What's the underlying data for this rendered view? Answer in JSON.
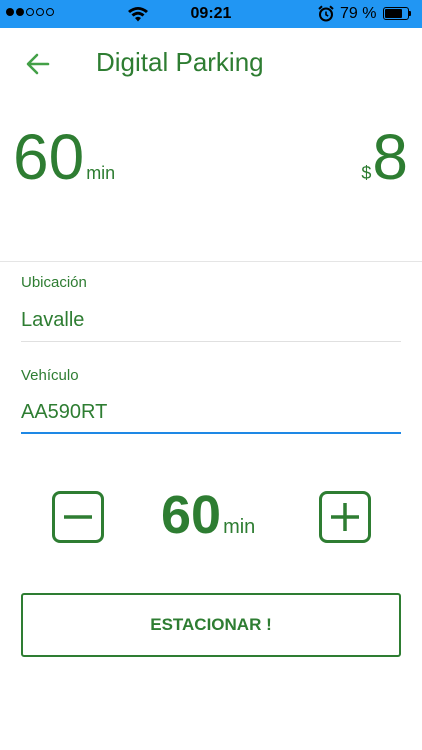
{
  "status_bar": {
    "time": "09:21",
    "battery_percent": "79 %",
    "battery_level": 0.79,
    "signal_bars_filled": 2,
    "signal_bars_total": 5,
    "icons": [
      "signal-dots-icon",
      "wifi-icon",
      "alarm-icon",
      "battery-icon"
    ],
    "background_color": "#2196f3"
  },
  "header": {
    "title": "Digital Parking",
    "back_icon": "arrow-left-icon"
  },
  "summary": {
    "duration_value": "60",
    "duration_unit": "min",
    "price_currency": "$",
    "price_value": "8"
  },
  "form": {
    "location": {
      "label": "Ubicación",
      "value": "Lavalle"
    },
    "vehicle": {
      "label": "Vehículo",
      "value": "AA590RT"
    }
  },
  "stepper": {
    "value": "60",
    "unit": "min",
    "decrement_icon": "minus-square-icon",
    "increment_icon": "plus-square-icon"
  },
  "actions": {
    "park_label": "ESTACIONAR !"
  },
  "colors": {
    "accent": "#2e7d32",
    "focus_underline": "#1e88e5",
    "divider": "#e5e5e5"
  }
}
